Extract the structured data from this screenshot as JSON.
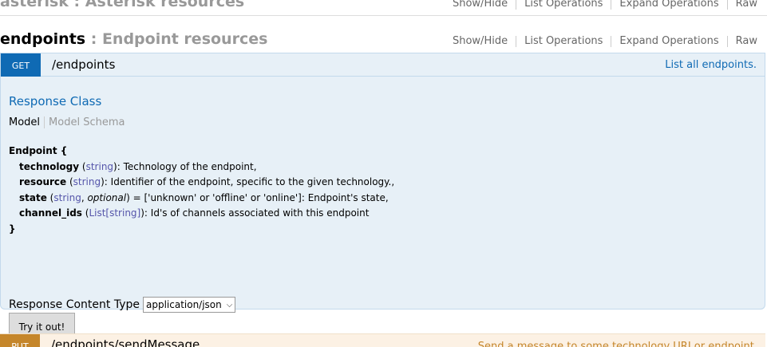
{
  "resources": [
    {
      "name": "asterisk",
      "description": "Asterisk resources",
      "separator": " : ",
      "options": [
        "Show/Hide",
        "List Operations",
        "Expand Operations",
        "Raw"
      ]
    },
    {
      "name": "endpoints",
      "description": "Endpoint resources",
      "separator": " : ",
      "options": [
        "Show/Hide",
        "List Operations",
        "Expand Operations",
        "Raw"
      ]
    }
  ],
  "operations": [
    {
      "method": "GET",
      "path": "/endpoints",
      "summary": "List all endpoints.",
      "response_class_label": "Response Class",
      "model_tab": "Model",
      "model_schema_tab": "Model Schema",
      "model": {
        "name": "Endpoint {",
        "close": "}",
        "properties": [
          {
            "name": "technology",
            "open": " (",
            "type": "string",
            "close": "): ",
            "description": "Technology of the endpoint,"
          },
          {
            "name": "resource",
            "open": " (",
            "type": "string",
            "close": "): ",
            "description": "Identifier of the endpoint, specific to the given technology.,"
          },
          {
            "name": "state",
            "open": " (",
            "type": "string",
            "sep": ", ",
            "optional": "optional",
            "close": ") = ['unknown' or 'offline' or 'online']: ",
            "description": "Endpoint's state,"
          },
          {
            "name": "channel_ids",
            "open": " (",
            "type": "List[string]",
            "close": "): ",
            "description": "Id's of channels associated with this endpoint"
          }
        ]
      },
      "content_type_label": "Response Content Type",
      "content_type_value": "application/json",
      "try_button": "Try it out!"
    },
    {
      "method": "PUT",
      "path": "/endpoints/sendMessage",
      "summary": "Send a message to some technology URI or endpoint."
    }
  ]
}
